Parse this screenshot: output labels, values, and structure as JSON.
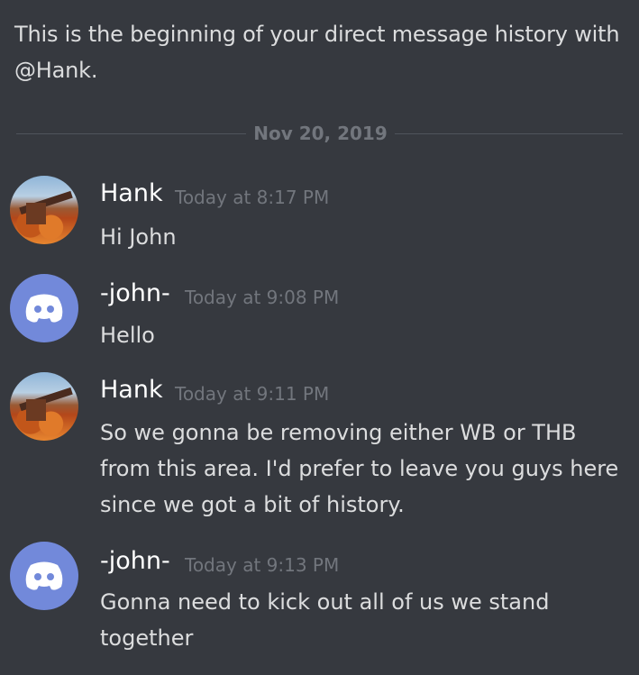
{
  "intro": {
    "text": "This is the beginning of your direct message history with @Hank."
  },
  "divider": {
    "date": "Nov 20, 2019"
  },
  "messages": [
    {
      "author": "Hank",
      "timestamp": "Today at 8:17 PM",
      "text": "Hi John",
      "avatar": "photo-avatar"
    },
    {
      "author": "-john-",
      "timestamp": "Today at 9:08 PM",
      "text": "Hello",
      "avatar": "discord-logo-icon"
    },
    {
      "author": "Hank",
      "timestamp": "Today at 9:11 PM",
      "text": "So we gonna be removing either WB or THB from this area. I'd prefer to leave you guys here since we got a bit of history.",
      "avatar": "photo-avatar"
    },
    {
      "author": "-john-",
      "timestamp": "Today at 9:13 PM",
      "text": "Gonna need to kick out all of us we stand together",
      "avatar": "discord-logo-icon"
    }
  ],
  "colors": {
    "background": "#36393f",
    "text": "#dcddde",
    "username": "#ffffff",
    "timestamp": "#72767d",
    "discord_blurple": "#7289da"
  }
}
